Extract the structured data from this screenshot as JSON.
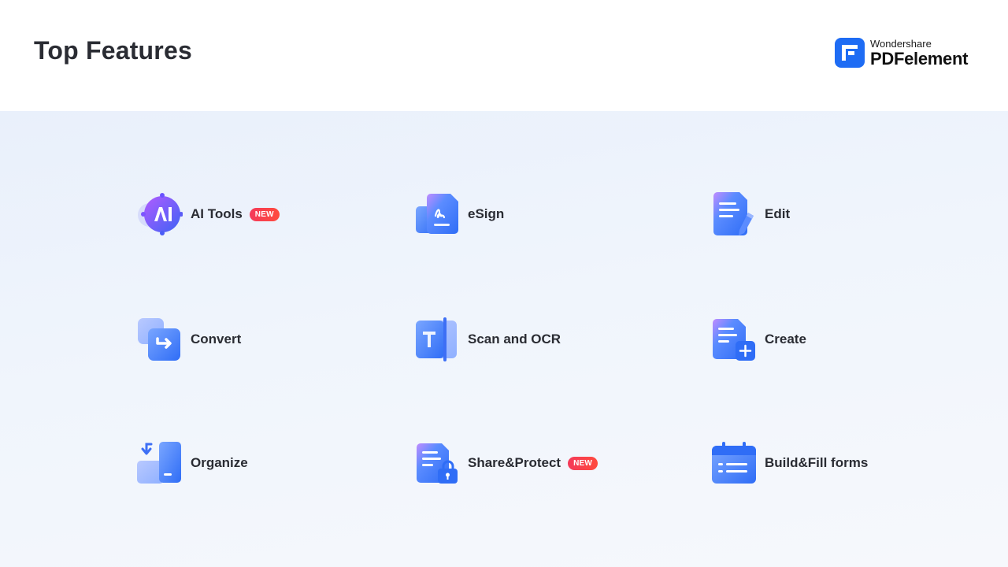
{
  "header": {
    "title": "Top Features",
    "brand_sub": "Wondershare",
    "brand_main": "PDFelement"
  },
  "colors": {
    "brand_blue": "#1e6cf4",
    "badge_red": "#f43a5a",
    "background_top": "#e9f0fb"
  },
  "features": [
    {
      "label": "AI Tools",
      "icon": "ai-tools-icon",
      "badge": "NEW"
    },
    {
      "label": "eSign",
      "icon": "esign-icon"
    },
    {
      "label": "Edit",
      "icon": "edit-icon"
    },
    {
      "label": "Convert",
      "icon": "convert-icon"
    },
    {
      "label": "Scan and OCR",
      "icon": "scan-ocr-icon"
    },
    {
      "label": "Create",
      "icon": "create-icon"
    },
    {
      "label": "Organize",
      "icon": "organize-icon"
    },
    {
      "label": "Share&Protect",
      "icon": "share-protect-icon",
      "badge": "NEW"
    },
    {
      "label": "Build&Fill forms",
      "icon": "build-fill-forms-icon"
    }
  ]
}
